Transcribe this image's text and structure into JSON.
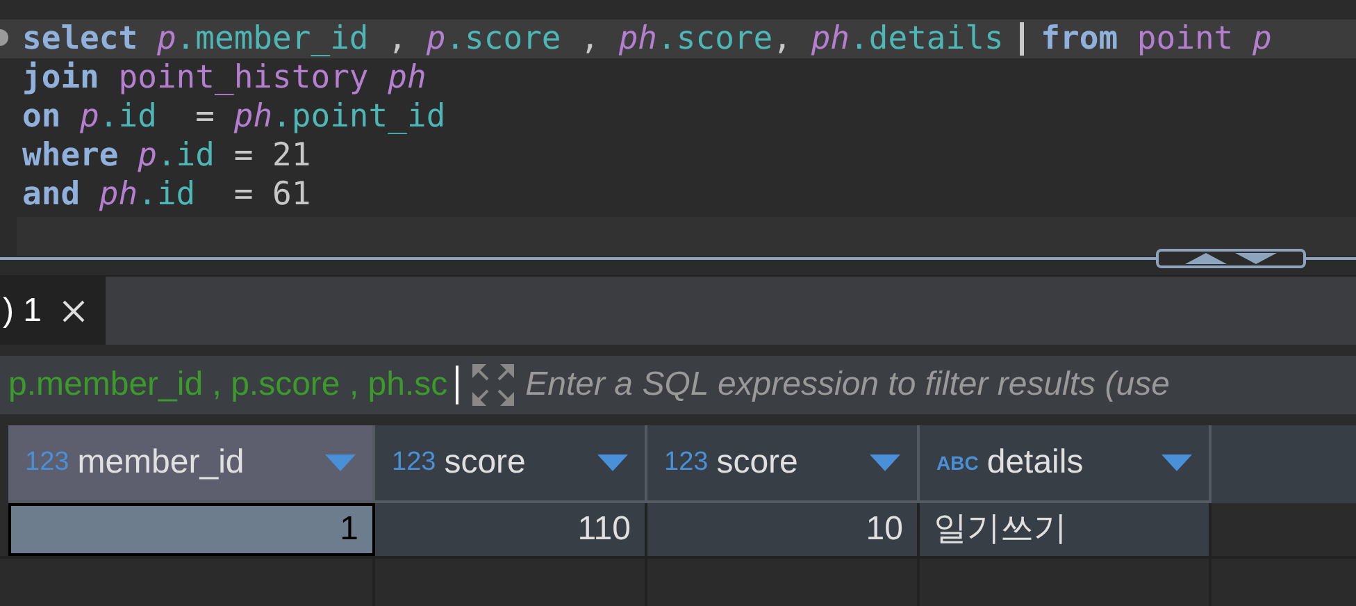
{
  "editor": {
    "lines": [
      {
        "current": true,
        "tokens": [
          {
            "kind": "keyword",
            "text": "select "
          },
          {
            "kind": "alias",
            "text": "p"
          },
          {
            "kind": "field",
            "text": ".member_id"
          },
          {
            "kind": "plain",
            "text": " , "
          },
          {
            "kind": "alias",
            "text": "p"
          },
          {
            "kind": "field",
            "text": ".score"
          },
          {
            "kind": "plain",
            "text": " , "
          },
          {
            "kind": "alias",
            "text": "ph"
          },
          {
            "kind": "field",
            "text": ".score"
          },
          {
            "kind": "plain",
            "text": ", "
          },
          {
            "kind": "alias",
            "text": "ph"
          },
          {
            "kind": "field",
            "text": ".details "
          },
          {
            "kind": "caret"
          },
          {
            "kind": "keyword",
            "text": "from "
          },
          {
            "kind": "table",
            "text": "point "
          },
          {
            "kind": "alias",
            "text": "p"
          }
        ]
      },
      {
        "current": false,
        "tokens": [
          {
            "kind": "keyword",
            "text": "join "
          },
          {
            "kind": "table",
            "text": "point_history "
          },
          {
            "kind": "alias",
            "text": "ph"
          }
        ]
      },
      {
        "current": false,
        "tokens": [
          {
            "kind": "keyword",
            "text": "on "
          },
          {
            "kind": "alias",
            "text": "p"
          },
          {
            "kind": "field",
            "text": ".id"
          },
          {
            "kind": "plain",
            "text": "  = "
          },
          {
            "kind": "alias",
            "text": "ph"
          },
          {
            "kind": "field",
            "text": ".point_id"
          }
        ]
      },
      {
        "current": false,
        "tokens": [
          {
            "kind": "keyword",
            "text": "where "
          },
          {
            "kind": "alias",
            "text": "p"
          },
          {
            "kind": "field",
            "text": ".id"
          },
          {
            "kind": "plain",
            "text": " = 21"
          }
        ]
      },
      {
        "current": false,
        "tokens": [
          {
            "kind": "keyword",
            "text": "and "
          },
          {
            "kind": "alias",
            "text": "ph"
          },
          {
            "kind": "field",
            "text": ".id"
          },
          {
            "kind": "plain",
            "text": "  = 61"
          }
        ]
      }
    ]
  },
  "tabs": [
    {
      "label": ") 1",
      "selected": true
    }
  ],
  "filter": {
    "value": "p.member_id , p.score , ph.sc",
    "placeholder": "Enter a SQL expression to filter results (use"
  },
  "table": {
    "columns": [
      {
        "type": "123",
        "name": "member_id",
        "kind": "number",
        "selected": true
      },
      {
        "type": "123",
        "name": "score",
        "kind": "number",
        "selected": false
      },
      {
        "type": "123",
        "name": "score",
        "kind": "number",
        "selected": false
      },
      {
        "type": "ABC",
        "name": "details",
        "kind": "text",
        "selected": false
      }
    ],
    "rows": [
      {
        "cells": [
          {
            "text": "1",
            "selected": true
          },
          {
            "text": "110",
            "selected": false
          },
          {
            "text": "10",
            "selected": false
          },
          {
            "text": "일기쓰기",
            "selected": false
          }
        ]
      }
    ]
  }
}
